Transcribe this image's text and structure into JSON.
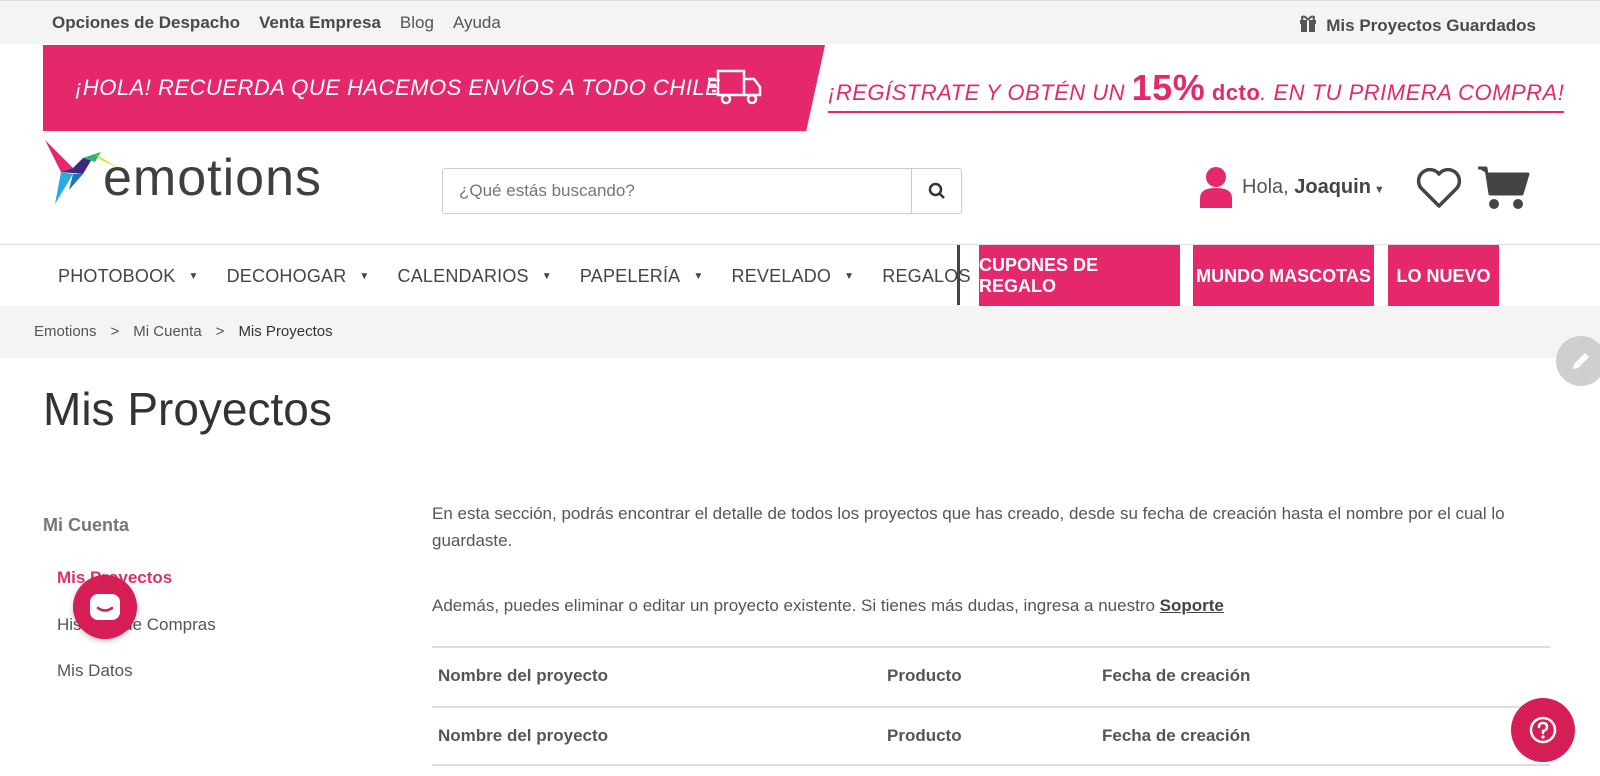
{
  "topbar": {
    "links": [
      "Opciones de Despacho",
      "Venta Empresa",
      "Blog",
      "Ayuda"
    ],
    "saved_projects": "Mis Proyectos Guardados"
  },
  "promo": {
    "left_text": "¡HOLA! RECUERDA QUE HACEMOS ENVÍOS A TODO CHILE",
    "right_pre": "¡REGÍSTRATE Y OBTÉN UN ",
    "right_percent": "15%",
    "right_dcto": " dcto",
    "right_post": ". EN TU PRIMERA COMPRA!"
  },
  "logo": {
    "text": "emotions"
  },
  "search": {
    "placeholder": "¿Qué estás buscando?"
  },
  "user": {
    "greeting": "Hola, ",
    "name": "Joaquin"
  },
  "nav": {
    "items": [
      "PHOTOBOOK",
      "DECOHOGAR",
      "CALENDARIOS",
      "PAPELERÍA",
      "REVELADO",
      "REGALOS"
    ],
    "highlights": [
      "CUPONES DE REGALO",
      "MUNDO MASCOTAS",
      "LO NUEVO"
    ]
  },
  "breadcrumb": [
    "Emotions",
    ">",
    "Mi Cuenta",
    ">",
    "Mis Proyectos"
  ],
  "page_title": "Mis Proyectos",
  "sidebar": {
    "heading": "Mi Cuenta",
    "items": [
      "Mis Proyectos",
      "Historial de Compras",
      "Mis Datos"
    ]
  },
  "content": {
    "paragraph1": "En esta sección, podrás encontrar el detalle de todos los proyectos que has creado, desde su fecha de creación hasta el nombre por el cual lo guardaste.",
    "paragraph2": "Además, puedes eliminar o editar un proyecto existente. Si tienes más dudas, ingresa a nuestro ",
    "support_link": "Soporte"
  },
  "table": {
    "headers": [
      "Nombre del proyecto",
      "Producto",
      "Fecha de creación"
    ],
    "rows": [
      [
        "Nombre del proyecto",
        "Producto",
        "Fecha de creación"
      ]
    ]
  },
  "colors": {
    "brand_pink": "#e5286b",
    "fab_pink": "#d51e55"
  },
  "icons": {
    "saved": "gift-icon",
    "search": "search-icon",
    "user": "user-icon",
    "wishlist": "heart-icon",
    "cart": "cart-icon",
    "chat": "chat-icon",
    "help": "help-icon",
    "edit": "pencil-icon",
    "truck": "truck-icon"
  }
}
